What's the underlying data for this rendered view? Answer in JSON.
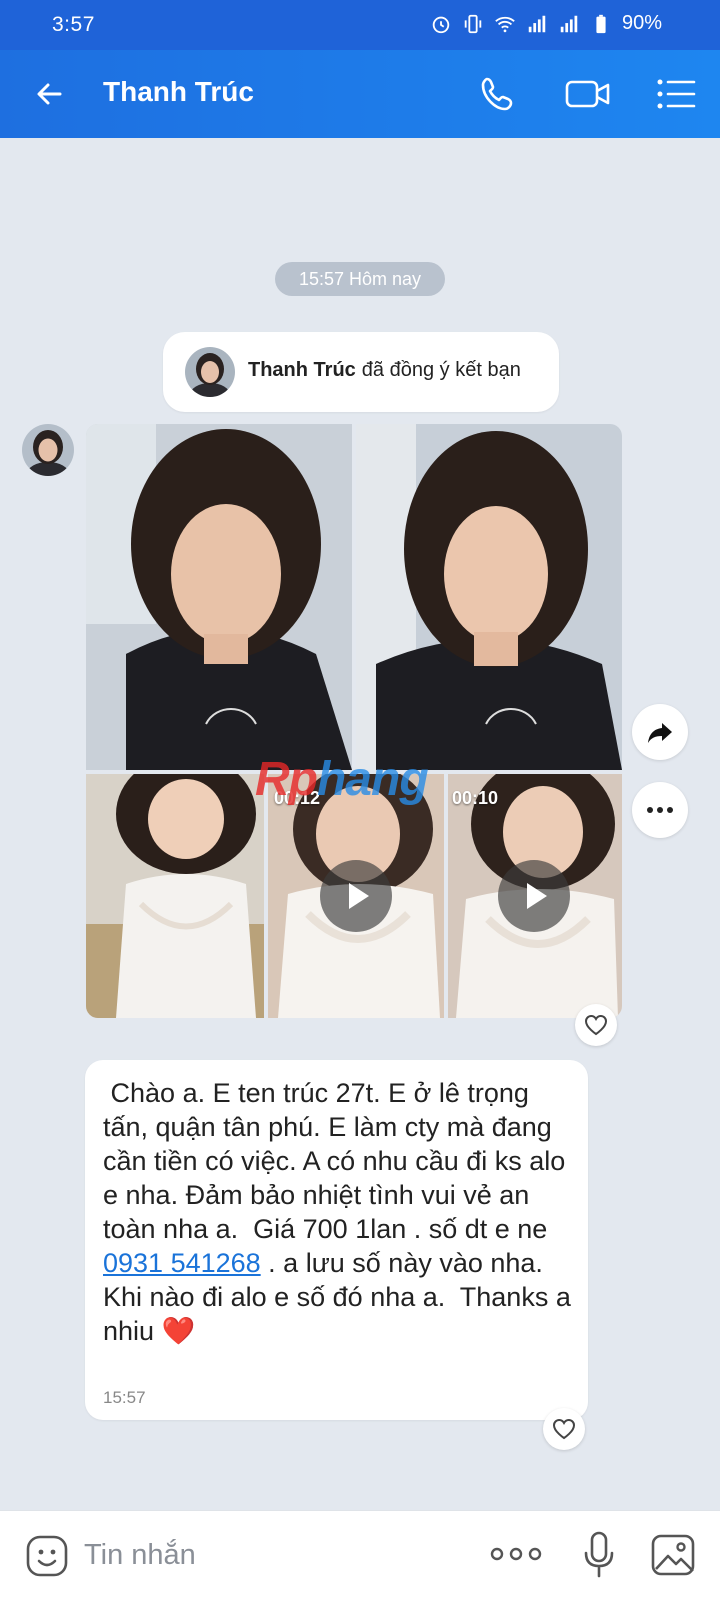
{
  "status": {
    "time": "3:57",
    "battery": "90%"
  },
  "header": {
    "contact_name": "Thanh Trúc"
  },
  "chat": {
    "time_divider": "15:57 Hôm nay",
    "friend_notice": {
      "name": "Thanh Trúc",
      "text": "đã đồng ý kết bạn"
    },
    "videos": [
      {
        "duration": "00:12"
      },
      {
        "duration": "00:10"
      }
    ],
    "watermark": {
      "part1": "Rp",
      "part2": "hang"
    },
    "message": {
      "text_before_phone": " Chào a. E ten trúc 27t. E ở lê trọng tấn, quận tân phú. E làm cty mà đang cần tiền có việc. A có nhu cầu đi ks alo e nha. Đảm bảo nhiệt tình vui vẻ an toàn nha a.  Giá 700 1lan . số dt e ne ",
      "phone": "0931 541268",
      "text_after_phone": " . a lưu số này vào nha. Khi nào đi alo e số đó nha a.  Thanks a nhiu ",
      "emoji": "❤️",
      "time": "15:57"
    }
  },
  "input": {
    "placeholder": "Tin nhắn"
  }
}
